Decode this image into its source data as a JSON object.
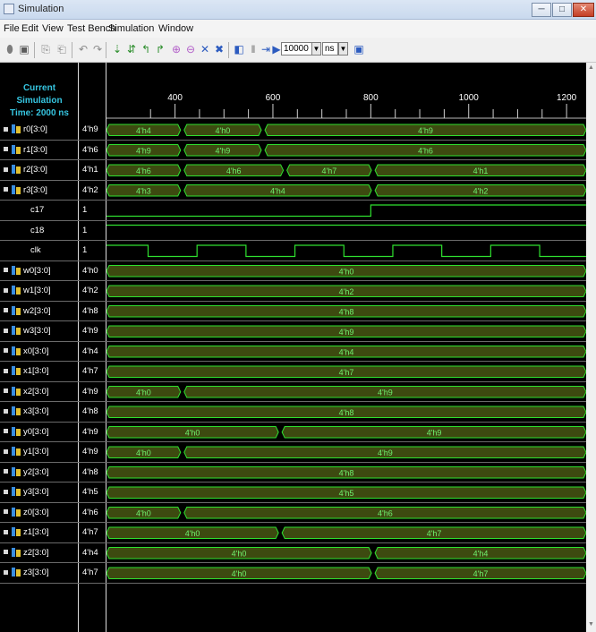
{
  "window": {
    "title": "Simulation",
    "buttons": {
      "min": "─",
      "max": "□",
      "close": "✕"
    }
  },
  "menu": [
    "File",
    "Edit",
    "View",
    "Test Bench",
    "Simulation",
    "Window"
  ],
  "toolbar": {
    "time_value": "10000",
    "time_unit": "ns"
  },
  "sim": {
    "current_label": "Current Simulation",
    "time_label": "Time: 2000 ns",
    "axis": {
      "start": 260,
      "end": 1240,
      "ticks": [
        400,
        600,
        800,
        1000,
        1200
      ]
    },
    "signals": [
      {
        "name": "r0[3:0]",
        "value": "4'h9",
        "kind": "bus",
        "segments": [
          {
            "from": 260,
            "to": 415,
            "label": "4'h4"
          },
          {
            "from": 415,
            "to": 580,
            "label": "4'h0"
          },
          {
            "from": 580,
            "to": 1240,
            "label": "4'h9"
          }
        ]
      },
      {
        "name": "r1[3:0]",
        "value": "4'h6",
        "kind": "bus",
        "segments": [
          {
            "from": 260,
            "to": 415,
            "label": "4'h9"
          },
          {
            "from": 415,
            "to": 580,
            "label": "4'h9"
          },
          {
            "from": 580,
            "to": 1240,
            "label": "4'h6"
          }
        ]
      },
      {
        "name": "r2[3:0]",
        "value": "4'h1",
        "kind": "bus",
        "segments": [
          {
            "from": 260,
            "to": 415,
            "label": "4'h6"
          },
          {
            "from": 415,
            "to": 625,
            "label": "4'h6"
          },
          {
            "from": 625,
            "to": 805,
            "label": "4'h7"
          },
          {
            "from": 805,
            "to": 1240,
            "label": "4'h1"
          }
        ]
      },
      {
        "name": "r3[3:0]",
        "value": "4'h2",
        "kind": "bus",
        "segments": [
          {
            "from": 260,
            "to": 415,
            "label": "4'h3"
          },
          {
            "from": 415,
            "to": 805,
            "label": "4'h4"
          },
          {
            "from": 805,
            "to": 1240,
            "label": "4'h2"
          }
        ]
      },
      {
        "name": "c17",
        "value": "1",
        "kind": "bit",
        "transitions": [
          [
            260,
            0
          ],
          [
            800,
            1
          ]
        ]
      },
      {
        "name": "c18",
        "value": "1",
        "kind": "bit",
        "transitions": [
          [
            260,
            1
          ]
        ]
      },
      {
        "name": "clk",
        "value": "1",
        "kind": "clock",
        "transitions": [
          [
            260,
            1
          ],
          [
            345,
            0
          ],
          [
            445,
            1
          ],
          [
            545,
            0
          ],
          [
            645,
            1
          ],
          [
            745,
            0
          ],
          [
            845,
            1
          ],
          [
            945,
            0
          ],
          [
            1045,
            1
          ],
          [
            1145,
            0
          ],
          [
            1240,
            0
          ]
        ]
      },
      {
        "name": "w0[3:0]",
        "value": "4'h0",
        "kind": "bus",
        "segments": [
          {
            "from": 260,
            "to": 1240,
            "label": "4'h0"
          }
        ]
      },
      {
        "name": "w1[3:0]",
        "value": "4'h2",
        "kind": "bus",
        "segments": [
          {
            "from": 260,
            "to": 1240,
            "label": "4'h2"
          }
        ]
      },
      {
        "name": "w2[3:0]",
        "value": "4'h8",
        "kind": "bus",
        "segments": [
          {
            "from": 260,
            "to": 1240,
            "label": "4'h8"
          }
        ]
      },
      {
        "name": "w3[3:0]",
        "value": "4'h9",
        "kind": "bus",
        "segments": [
          {
            "from": 260,
            "to": 1240,
            "label": "4'h9"
          }
        ]
      },
      {
        "name": "x0[3:0]",
        "value": "4'h4",
        "kind": "bus",
        "segments": [
          {
            "from": 260,
            "to": 1240,
            "label": "4'h4"
          }
        ]
      },
      {
        "name": "x1[3:0]",
        "value": "4'h7",
        "kind": "bus",
        "segments": [
          {
            "from": 260,
            "to": 1240,
            "label": "4'h7"
          }
        ]
      },
      {
        "name": "x2[3:0]",
        "value": "4'h9",
        "kind": "bus",
        "segments": [
          {
            "from": 260,
            "to": 415,
            "label": "4'h0"
          },
          {
            "from": 415,
            "to": 1240,
            "label": "4'h9"
          }
        ]
      },
      {
        "name": "x3[3:0]",
        "value": "4'h8",
        "kind": "bus",
        "segments": [
          {
            "from": 260,
            "to": 1240,
            "label": "4'h8"
          }
        ]
      },
      {
        "name": "y0[3:0]",
        "value": "4'h9",
        "kind": "bus",
        "segments": [
          {
            "from": 260,
            "to": 615,
            "label": "4'h0"
          },
          {
            "from": 615,
            "to": 1240,
            "label": "4'h9"
          }
        ]
      },
      {
        "name": "y1[3:0]",
        "value": "4'h9",
        "kind": "bus",
        "segments": [
          {
            "from": 260,
            "to": 415,
            "label": "4'h0"
          },
          {
            "from": 415,
            "to": 1240,
            "label": "4'h9"
          }
        ]
      },
      {
        "name": "y2[3:0]",
        "value": "4'h8",
        "kind": "bus",
        "segments": [
          {
            "from": 260,
            "to": 1240,
            "label": "4'h8"
          }
        ]
      },
      {
        "name": "y3[3:0]",
        "value": "4'h5",
        "kind": "bus",
        "segments": [
          {
            "from": 260,
            "to": 1240,
            "label": "4'h5"
          }
        ]
      },
      {
        "name": "z0[3:0]",
        "value": "4'h6",
        "kind": "bus",
        "segments": [
          {
            "from": 260,
            "to": 415,
            "label": "4'h0"
          },
          {
            "from": 415,
            "to": 1240,
            "label": "4'h6"
          }
        ]
      },
      {
        "name": "z1[3:0]",
        "value": "4'h7",
        "kind": "bus",
        "segments": [
          {
            "from": 260,
            "to": 615,
            "label": "4'h0"
          },
          {
            "from": 615,
            "to": 1240,
            "label": "4'h7"
          }
        ]
      },
      {
        "name": "z2[3:0]",
        "value": "4'h4",
        "kind": "bus",
        "segments": [
          {
            "from": 260,
            "to": 805,
            "label": "4'h0"
          },
          {
            "from": 805,
            "to": 1240,
            "label": "4'h4"
          }
        ]
      },
      {
        "name": "z3[3:0]",
        "value": "4'h7",
        "kind": "bus",
        "segments": [
          {
            "from": 260,
            "to": 805,
            "label": "4'h0"
          },
          {
            "from": 805,
            "to": 1240,
            "label": "4'h7"
          }
        ]
      }
    ]
  },
  "colors": {
    "wave_green": "#2fe02f",
    "bus_fill": "#3d4a10",
    "label_green": "#6ff26f",
    "signal_name_cyan": "#36c5e0"
  }
}
